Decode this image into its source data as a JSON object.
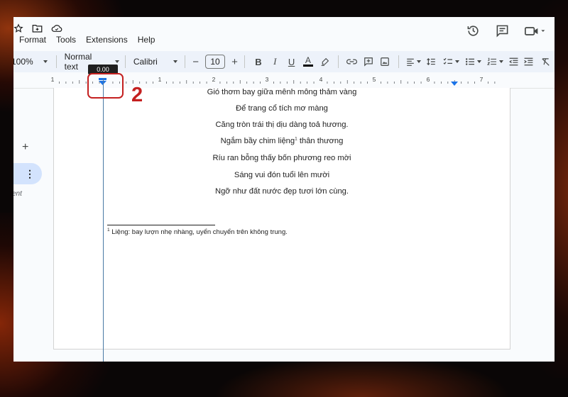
{
  "menu": {
    "items": [
      {
        "label": "Format"
      },
      {
        "label": "Tools"
      },
      {
        "label": "Extensions"
      },
      {
        "label": "Help"
      }
    ]
  },
  "toolbar": {
    "zoom": "100%",
    "style": "Normal text",
    "font": "Calibri",
    "font_size": "10",
    "text_color": "#000000"
  },
  "ruler": {
    "numbers": [
      "1",
      "1",
      "2",
      "3",
      "4",
      "5",
      "6",
      "7"
    ],
    "tooltip": "0.00"
  },
  "sidebar": {
    "partial_text": "ent"
  },
  "document": {
    "poem_lines": [
      "Gió thơm bay giữa mênh mông thảm vàng",
      "Để trang cổ tích mơ màng",
      "Căng tròn trái thị dịu dàng toả hương.",
      {
        "before": "Ngắm bầy chim liệng",
        "sup": "1",
        "after": " thân thương"
      },
      "Ríu ran bỗng thấy bốn phương reo mời",
      "Sáng vui đón tuổi lên mười",
      "Ngỡ như đất nước đẹp tươi lớn cùng."
    ],
    "footnote": {
      "marker": "1",
      "text": " Liệng: bay lượn nhẹ nhàng, uyển chuyển trên không trung."
    }
  },
  "annotation": {
    "number": "2",
    "color": "#c42020"
  }
}
